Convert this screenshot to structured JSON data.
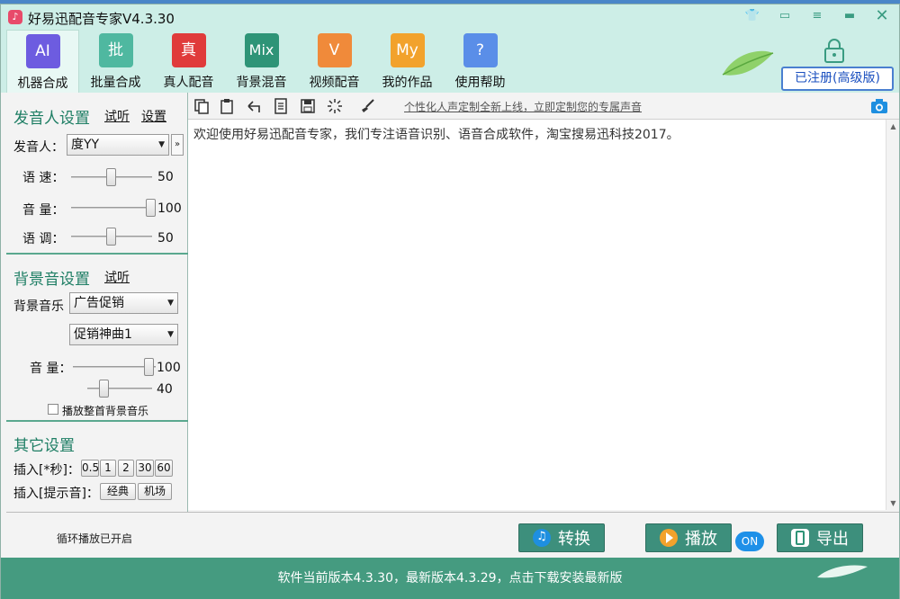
{
  "window": {
    "title": "好易迅配音专家V4.3.30"
  },
  "nav": [
    {
      "tile": "AI",
      "label": "机器合成"
    },
    {
      "tile": "批",
      "label": "批量合成"
    },
    {
      "tile": "真",
      "label": "真人配音"
    },
    {
      "tile": "Mix",
      "label": "背景混音"
    },
    {
      "tile": "V",
      "label": "视频配音"
    },
    {
      "tile": "My",
      "label": "我的作品"
    },
    {
      "tile": "?",
      "label": "使用帮助"
    }
  ],
  "header": {
    "registered": "已注册(高级版)"
  },
  "voice": {
    "heading": "发音人设置",
    "preview": "试听",
    "settings": "设置",
    "speaker_label": "发音人：",
    "speaker": "度YY",
    "speed_label": "语 速：",
    "speed": "50",
    "volume_label": "音 量：",
    "volume": "100",
    "pitch_label": "语 调：",
    "pitch": "50"
  },
  "bgm": {
    "heading": "背景音设置",
    "preview": "试听",
    "music_label": "背景音乐",
    "category": "广告促销",
    "track": "促销神曲1",
    "volume_label": "音 量：",
    "volume": "100",
    "second_value": "40",
    "play_full": "播放整首背景音乐"
  },
  "other": {
    "heading": "其它设置",
    "insert_pause_label": "插入[*秒]：",
    "pauses": [
      "0.5",
      "1",
      "2",
      "30",
      "60"
    ],
    "insert_tone_label": "插入[提示音]：",
    "tones": [
      "经典",
      "机场"
    ]
  },
  "editor": {
    "promo": "个性化人声定制全新上线，立即定制您的专属声音",
    "text": "欢迎使用好易迅配音专家，我们专注语音识别、语音合成软件，淘宝搜易迅科技2017。"
  },
  "actions": {
    "loop_status": "循环播放已开启",
    "convert": "转换",
    "play": "播放",
    "on": "ON",
    "export": "导出"
  },
  "status": {
    "message": "软件当前版本4.3.30，最新版本4.3.29，点击下载安装最新版"
  }
}
